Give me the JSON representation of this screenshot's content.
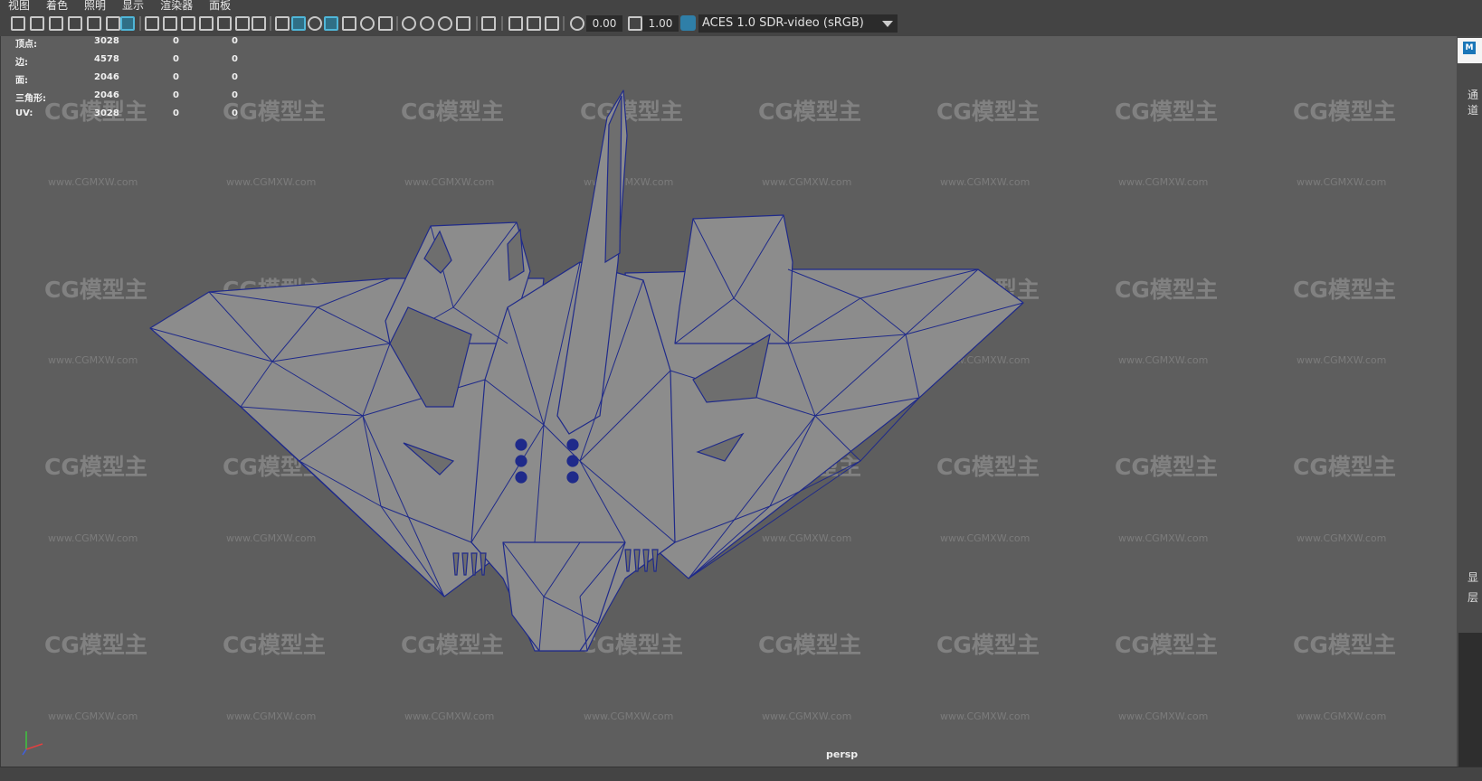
{
  "menu": [
    "视图",
    "着色",
    "照明",
    "显示",
    "渲染器",
    "面板"
  ],
  "toolbar": {
    "exposure_value": "0.00",
    "gamma_value": "1.00",
    "color_space": "ACES 1.0 SDR-video (sRGB)"
  },
  "hud_stats": [
    {
      "label": "顶点:",
      "v1": "3028",
      "v2": "0",
      "v3": "0"
    },
    {
      "label": "边:",
      "v1": "4578",
      "v2": "0",
      "v3": "0"
    },
    {
      "label": "面:",
      "v1": "2046",
      "v2": "0",
      "v3": "0"
    },
    {
      "label": "三角形:",
      "v1": "2046",
      "v2": "0",
      "v3": "0"
    },
    {
      "label": "UV:",
      "v1": "3028",
      "v2": "0",
      "v3": "0"
    }
  ],
  "camera_label": "persp",
  "watermark_logo": "CG模型主",
  "watermark_url": "www.CGMXW.com",
  "side_panel": {
    "badge": "M",
    "channel_label": "通道",
    "display_label": "显",
    "layer_label": "层"
  },
  "colors": {
    "viewport_bg": "#5e5e5e",
    "wire": "#1f2a8a",
    "shaded": "#8c8c8c",
    "ui_dark": "#444444"
  },
  "icons": [
    "camera-icon",
    "grid-icon",
    "wireframe-cube-icon",
    "shaded-cube-icon",
    "light-icon",
    "sphere-icon",
    "select-icon",
    "exposure-icon",
    "gamma-icon",
    "color-space-icon"
  ]
}
